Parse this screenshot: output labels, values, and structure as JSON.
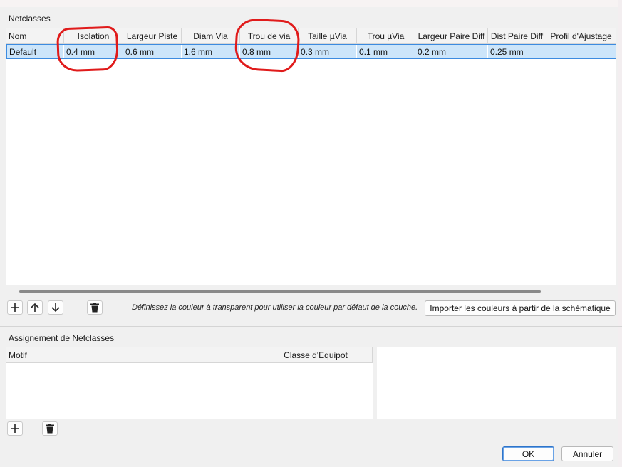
{
  "netclasses": {
    "title": "Netclasses",
    "columns": [
      "Nom",
      "Isolation",
      "Largeur Piste",
      "Diam Via",
      "Trou de via",
      "Taille µVia",
      "Trou µVia",
      "Largeur Paire Diff",
      "Dist Paire Diff",
      "Profil d'Ajustage"
    ],
    "rows": [
      [
        "Default",
        "0.4 mm",
        "0.6 mm",
        "1.6 mm",
        "0.8 mm",
        "0.3 mm",
        "0.1 mm",
        "0.2 mm",
        "0.25 mm",
        ""
      ]
    ],
    "hint": "Définissez la couleur à transparent pour utiliser la couleur par défaut de la couche.",
    "import_button": "Importer les couleurs à partir de la schématique"
  },
  "assignment": {
    "title": "Assignement de Netclasses",
    "columns": [
      "Motif",
      "Classe d'Equipot"
    ]
  },
  "buttons": {
    "ok": "OK",
    "cancel": "Annuler"
  },
  "icons": [
    "plus-icon",
    "arrow-up-icon",
    "arrow-down-icon",
    "trash-icon"
  ],
  "colors": {
    "selection": "#cce5fa",
    "selection_border": "#3c8be0",
    "annotation": "#e01b1b"
  }
}
